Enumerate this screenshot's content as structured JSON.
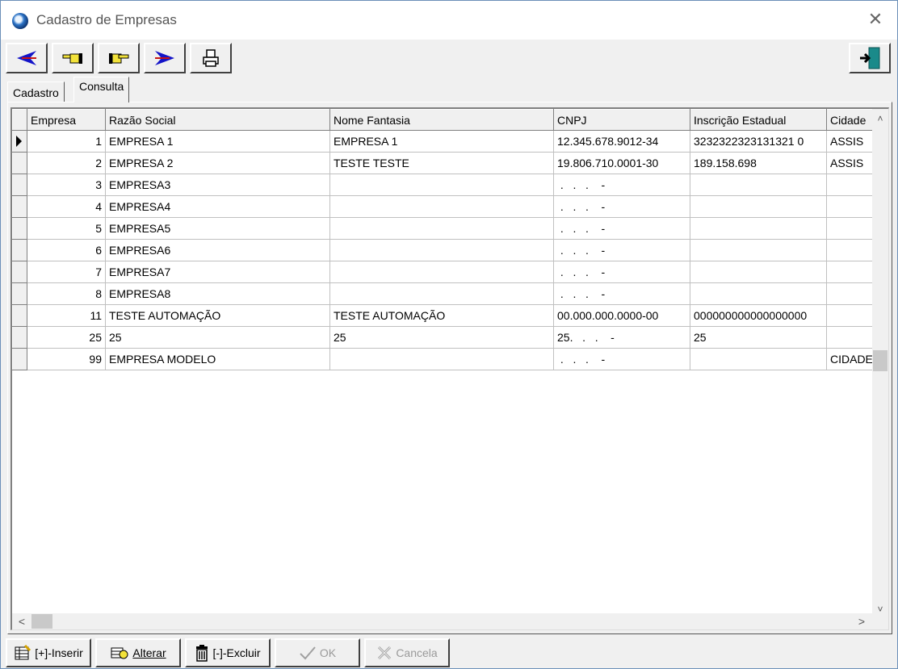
{
  "window": {
    "title": "Cadastro de Empresas"
  },
  "toolbar": {
    "buttons": [
      {
        "icon": "blue-arrow-left-icon",
        "color": "#1414c8"
      },
      {
        "icon": "hand-point-left-icon"
      },
      {
        "icon": "hand-point-right-icon"
      },
      {
        "icon": "blue-arrow-right-icon",
        "color": "#1414c8"
      },
      {
        "icon": "printer-icon"
      }
    ],
    "exit": {
      "icon": "exit-door-icon",
      "color": "#1a8a8a"
    }
  },
  "tabs": [
    {
      "label": "Cadastro",
      "active": false
    },
    {
      "label": "Consulta",
      "active": true
    }
  ],
  "grid": {
    "columns": [
      "Empresa",
      "Razão Social",
      "Nome Fantasia",
      "CNPJ",
      "Inscrição Estadual",
      "Cidade"
    ],
    "rows": [
      {
        "current": true,
        "cells": [
          "1",
          "EMPRESA 1",
          "EMPRESA 1",
          "12.345.678.9012-34",
          "3232322323131321 0",
          "ASSIS"
        ]
      },
      {
        "current": false,
        "cells": [
          "2",
          "EMPRESA 2",
          "TESTE TESTE",
          "19.806.710.0001-30",
          "189.158.698",
          "ASSIS"
        ]
      },
      {
        "current": false,
        "cells": [
          "3",
          "EMPRESA3",
          "",
          " .   .   .    -",
          "",
          ""
        ]
      },
      {
        "current": false,
        "cells": [
          "4",
          "EMPRESA4",
          "",
          " .   .   .    -",
          "",
          ""
        ]
      },
      {
        "current": false,
        "cells": [
          "5",
          "EMPRESA5",
          "",
          " .   .   .    -",
          "",
          ""
        ]
      },
      {
        "current": false,
        "cells": [
          "6",
          "EMPRESA6",
          "",
          " .   .   .    -",
          "",
          ""
        ]
      },
      {
        "current": false,
        "cells": [
          "7",
          "EMPRESA7",
          "",
          " .   .   .    -",
          "",
          ""
        ]
      },
      {
        "current": false,
        "cells": [
          "8",
          "EMPRESA8",
          "",
          " .   .   .    -",
          "",
          ""
        ]
      },
      {
        "current": false,
        "cells": [
          "11",
          "TESTE AUTOMAÇÃO",
          "TESTE AUTOMAÇÃO",
          "00.000.000.0000-00",
          "000000000000000000",
          ""
        ]
      },
      {
        "current": false,
        "cells": [
          "25",
          "25",
          "25",
          "25.   .   .    -",
          "25",
          ""
        ]
      },
      {
        "current": false,
        "cells": [
          "99",
          "EMPRESA MODELO",
          "",
          " .   .   .    -",
          "",
          "CIDADE"
        ]
      }
    ]
  },
  "bottom_buttons": [
    {
      "label": "[+]-Inserir",
      "icon": "insert-record-icon",
      "enabled": true
    },
    {
      "label": "Alterar",
      "icon": "edit-record-icon",
      "enabled": true
    },
    {
      "label": "[-]-Excluir",
      "icon": "trash-icon",
      "enabled": true
    },
    {
      "label": "OK",
      "icon": "checkmark-icon",
      "enabled": false
    },
    {
      "label": "Cancela",
      "icon": "cancel-x-icon",
      "enabled": false
    }
  ],
  "scrollbars": {
    "up_glyph": "˄",
    "down_glyph": "˅",
    "left_glyph": "<",
    "right_glyph": ">"
  }
}
